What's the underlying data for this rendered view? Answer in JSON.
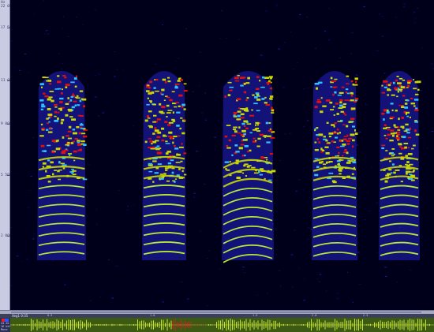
{
  "freq_axis": {
    "labels": [
      "Hz",
      "22 050",
      "17 500",
      "11 000",
      "9 000",
      "5 500",
      "2 000"
    ]
  },
  "waveform_track": {
    "name": "Xeg1 0:35",
    "channel_lines": [
      "44.1k",
      "16 bit",
      "Mono"
    ],
    "time_labels": [
      "0.5",
      "1.0",
      "1.5",
      "2.0",
      "2.5"
    ]
  },
  "spectrogram": {
    "calls": 5,
    "colors": {
      "background": "#00001a",
      "low": "#2020c8",
      "mid": "#c8d800",
      "high": "#e01010",
      "harmonic": "#c8ff30"
    }
  },
  "colors": {
    "axis_panel": "#c9cbe3",
    "waveform_bg": "#3c5a14",
    "waveform_signal": "#c8e830",
    "selection": "#d02020"
  }
}
